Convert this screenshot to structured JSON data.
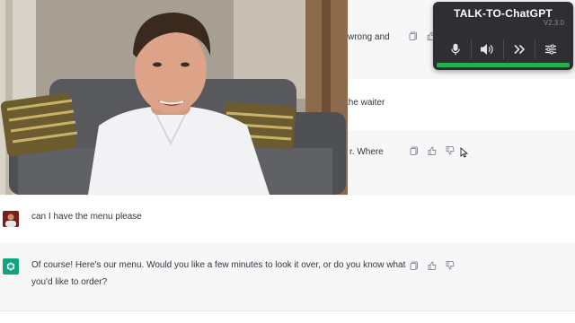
{
  "conversation": {
    "messages": [
      {
        "role": "assistant",
        "text": "wrong and"
      },
      {
        "role": "user",
        "text": "the waiter"
      },
      {
        "role": "assistant",
        "text": "r. Where"
      },
      {
        "role": "user",
        "text": "can I have the menu please"
      },
      {
        "role": "assistant",
        "text_line1": "Of course! Here's our menu. Would you like a few minutes to look it over, or do you know what",
        "text_line2": "you'd like to order?"
      }
    ]
  },
  "extension": {
    "title": "TALK-TO-ChatGPT",
    "version": "V2.3.0",
    "buttons": [
      "microphone-icon",
      "speaker-icon",
      "skip-icon",
      "settings-icon"
    ],
    "progress_fraction": 1.0,
    "progress_color": "#22b14c"
  },
  "colors": {
    "assistant_row_bg": "#f7f7f8",
    "chatgpt_avatar": "#10a37f",
    "widget_bg": "#2f2f33"
  }
}
